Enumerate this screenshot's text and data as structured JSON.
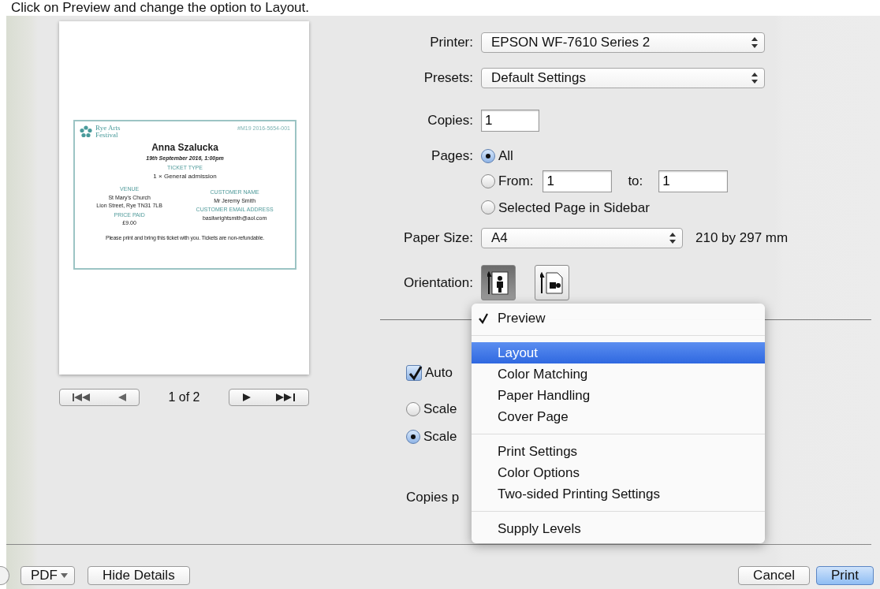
{
  "caption": "Click on Preview and change the option to Layout.",
  "preview": {
    "ticket": {
      "logo_text": "Rye Arts Festival",
      "reference": "#M19 2016-5654-001",
      "name": "Anna Szalucka",
      "date": "19th September 2016, 1:00pm",
      "ticket_type_label": "TICKET TYPE",
      "ticket_type": "1 × General admission",
      "venue_label": "VENUE",
      "venue_lines": [
        "St Mary's Church",
        "Lion Street, Rye TN31 7LB"
      ],
      "price_label": "PRICE PAID",
      "price": "£9.00",
      "customer_name_label": "CUSTOMER NAME",
      "customer_name": "Mr Jeremy Smith",
      "customer_email_label": "CUSTOMER EMAIL ADDRESS",
      "customer_email": "basilwrightsmith@aol.com",
      "footer": "Please print and bring this ticket with you. Tickets are non-refundable."
    },
    "pager": "1 of 2"
  },
  "printer": {
    "label": "Printer:",
    "value": "EPSON WF-7610 Series 2"
  },
  "presets": {
    "label": "Presets:",
    "value": "Default Settings"
  },
  "copies": {
    "label": "Copies:",
    "value": "1"
  },
  "pages": {
    "label": "Pages:",
    "options": [
      {
        "kind": "all",
        "label": "All",
        "selected": true
      },
      {
        "kind": "range",
        "label": "From:",
        "selected": false,
        "from": "1",
        "to_label": "to:",
        "to": "1"
      },
      {
        "kind": "sidebar",
        "label": "Selected Page in Sidebar",
        "selected": false
      }
    ]
  },
  "paper_size": {
    "label": "Paper Size:",
    "value": "A4",
    "dimensions": "210 by 297 mm"
  },
  "orientation": {
    "label": "Orientation:",
    "options": [
      {
        "kind": "portrait",
        "selected": true
      },
      {
        "kind": "landscape",
        "selected": false
      }
    ]
  },
  "section_options": [
    {
      "kind": "checkbox",
      "label": "Auto",
      "checked": true
    },
    {
      "kind": "radio",
      "label": "Scale",
      "selected": false
    },
    {
      "kind": "radio",
      "label": "Scale",
      "selected": true
    },
    {
      "kind": "text",
      "label": "Copies p"
    }
  ],
  "menu": {
    "groups": [
      {
        "items": [
          {
            "label": "Preview",
            "checked": true,
            "selected": false
          }
        ]
      },
      {
        "items": [
          {
            "label": "Layout",
            "checked": false,
            "selected": true
          },
          {
            "label": "Color Matching",
            "checked": false,
            "selected": false
          },
          {
            "label": "Paper Handling",
            "checked": false,
            "selected": false
          },
          {
            "label": "Cover Page",
            "checked": false,
            "selected": false
          }
        ]
      },
      {
        "items": [
          {
            "label": "Print Settings",
            "checked": false,
            "selected": false
          },
          {
            "label": "Color Options",
            "checked": false,
            "selected": false
          },
          {
            "label": "Two-sided Printing Settings",
            "checked": false,
            "selected": false
          }
        ]
      },
      {
        "items": [
          {
            "label": "Supply Levels",
            "checked": false,
            "selected": false
          }
        ]
      }
    ]
  },
  "footer": {
    "pdf": "PDF",
    "buttons": [
      {
        "kind": "plain",
        "label": "Hide Details"
      },
      {
        "kind": "plain",
        "label": "Cancel"
      },
      {
        "kind": "default",
        "label": "Print"
      }
    ]
  }
}
